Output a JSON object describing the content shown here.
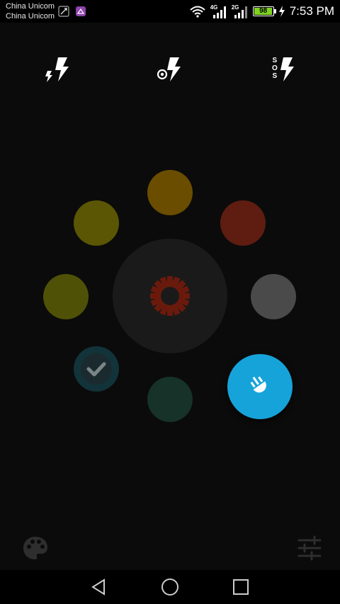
{
  "status_bar": {
    "carrier_1": "China Unicom",
    "carrier_2": "China Unicom",
    "network_1": "4G",
    "network_2": "2G",
    "battery_level": "98",
    "time": "7:53 PM"
  },
  "modes": {
    "flash_icon": "lightning-bolt-icon",
    "strobe_icon": "target-lightning-icon",
    "sos_icon": "sos-lightning-icon",
    "sos_letters": [
      "S",
      "O",
      "S"
    ]
  },
  "colors": {
    "background": "#0b0b0b",
    "dot_orange": "#6b4d00",
    "dot_red": "#5e1d10",
    "dot_yellow_top": "#5b5604",
    "dot_yellow_left": "#4f5206",
    "dot_gray": "#4a4a4a",
    "dot_teal_selected": "#12333a",
    "dot_dark_green": "#173228",
    "accent_blue": "#16a3d9",
    "gear_red": "#6a1a0c"
  },
  "icons": {
    "center": "gear-icon",
    "fab": "flashlight-icon",
    "palette": "palette-icon",
    "settings": "sliders-icon",
    "check": "checkmark-icon"
  }
}
